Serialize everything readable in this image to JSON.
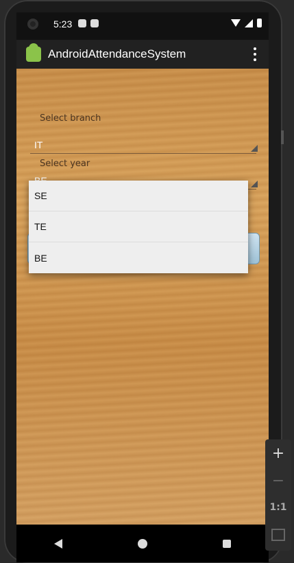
{
  "status_bar": {
    "time": "5:23"
  },
  "app_bar": {
    "title": "AndroidAttendanceSystem",
    "icon": "android-icon"
  },
  "form": {
    "branch_label": "Select branch",
    "branch_value": "IT",
    "year_label": "Select year",
    "year_value": "BE"
  },
  "dropdown": {
    "options": [
      "SE",
      "TE",
      "BE"
    ]
  },
  "emulator_controls": {
    "zoom_in": "+",
    "zoom_out": "−",
    "actual_size": "1:1"
  }
}
